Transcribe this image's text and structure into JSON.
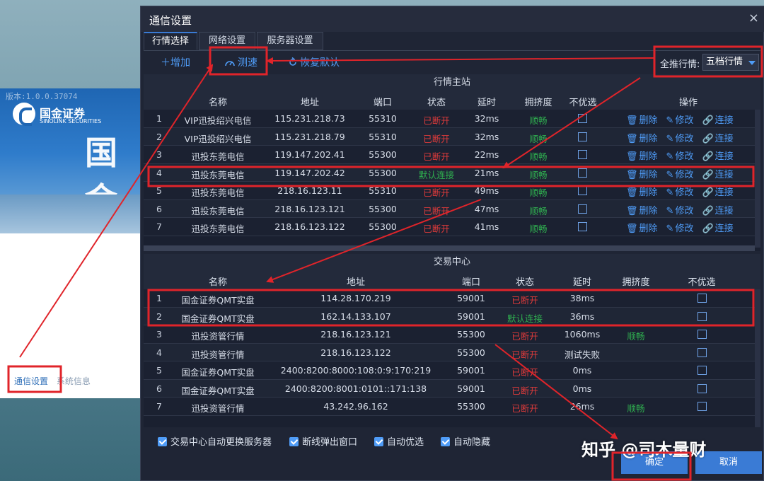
{
  "background_window": {
    "version": "版本:1.0.0.37074",
    "brand": "国金证券",
    "brand_en": "SINOLINK SECURITIES",
    "big_text": "国金",
    "links": [
      "通信设置",
      "系统信息"
    ]
  },
  "dialog": {
    "title": "通信设置",
    "close": "×",
    "tabs": [
      "行情选择",
      "网络设置",
      "服务器设置"
    ],
    "toolbar": {
      "add": "＋增加",
      "speed_test": "测速",
      "restore_default": "恢复默认",
      "push_label": "全推行情:",
      "push_value": "五档行情"
    },
    "market_panel": {
      "title": "行情主站",
      "headers": [
        "名称",
        "地址",
        "端口",
        "状态",
        "延时",
        "拥挤度",
        "不优选",
        "操作"
      ],
      "ops": [
        "删除",
        "修改",
        "连接"
      ],
      "rows": [
        {
          "no": "1",
          "name": "VIP迅投绍兴电信",
          "addr": "115.231.218.73",
          "port": "55310",
          "status": "已断开",
          "status_type": "red",
          "delay": "32ms",
          "crowd": "顺畅"
        },
        {
          "no": "2",
          "name": "VIP迅投绍兴电信",
          "addr": "115.231.218.79",
          "port": "55310",
          "status": "已断开",
          "status_type": "red",
          "delay": "32ms",
          "crowd": "顺畅"
        },
        {
          "no": "3",
          "name": "迅投东莞电信",
          "addr": "119.147.202.41",
          "port": "55300",
          "status": "已断开",
          "status_type": "red",
          "delay": "22ms",
          "crowd": "顺畅"
        },
        {
          "no": "4",
          "name": "迅投东莞电信",
          "addr": "119.147.202.42",
          "port": "55300",
          "status": "默认连接",
          "status_type": "green",
          "delay": "21ms",
          "crowd": "顺畅"
        },
        {
          "no": "5",
          "name": "迅投东莞电信",
          "addr": "218.16.123.11",
          "port": "55310",
          "status": "已断开",
          "status_type": "red",
          "delay": "49ms",
          "crowd": "顺畅"
        },
        {
          "no": "6",
          "name": "迅投东莞电信",
          "addr": "218.16.123.121",
          "port": "55300",
          "status": "已断开",
          "status_type": "red",
          "delay": "47ms",
          "crowd": "顺畅"
        },
        {
          "no": "7",
          "name": "迅投东莞电信",
          "addr": "218.16.123.122",
          "port": "55300",
          "status": "已断开",
          "status_type": "red",
          "delay": "41ms",
          "crowd": "顺畅"
        }
      ]
    },
    "trade_panel": {
      "title": "交易中心",
      "headers": [
        "名称",
        "地址",
        "端口",
        "状态",
        "延时",
        "拥挤度",
        "不优选"
      ],
      "rows": [
        {
          "no": "1",
          "name": "国金证券QMT实盘",
          "addr": "114.28.170.219",
          "port": "59001",
          "status": "已断开",
          "status_type": "red",
          "delay": "38ms",
          "crowd": ""
        },
        {
          "no": "2",
          "name": "国金证券QMT实盘",
          "addr": "162.14.133.107",
          "port": "59001",
          "status": "默认连接",
          "status_type": "green",
          "delay": "36ms",
          "crowd": ""
        },
        {
          "no": "3",
          "name": "迅投资管行情",
          "addr": "218.16.123.121",
          "port": "55300",
          "status": "已断开",
          "status_type": "red",
          "delay": "1060ms",
          "crowd": "顺畅"
        },
        {
          "no": "4",
          "name": "迅投资管行情",
          "addr": "218.16.123.122",
          "port": "55300",
          "status": "已断开",
          "status_type": "red",
          "delay": "测试失败",
          "crowd": ""
        },
        {
          "no": "5",
          "name": "国金证券QMT实盘",
          "addr": "2400:8200:8000:108:0:9:170:219",
          "port": "59001",
          "status": "已断开",
          "status_type": "red",
          "delay": "0ms",
          "crowd": ""
        },
        {
          "no": "6",
          "name": "国金证券QMT实盘",
          "addr": "2400:8200:8001:0101::171:138",
          "port": "59001",
          "status": "已断开",
          "status_type": "red",
          "delay": "0ms",
          "crowd": ""
        },
        {
          "no": "7",
          "name": "迅投资管行情",
          "addr": "43.242.96.162",
          "port": "55300",
          "status": "已断开",
          "status_type": "red",
          "delay": "26ms",
          "crowd": "顺畅"
        }
      ]
    },
    "options": [
      "交易中心自动更换服务器",
      "断线弹出窗口",
      "自动优选",
      "自动隐藏"
    ],
    "buttons": {
      "ok": "确定",
      "cancel": "取消"
    }
  },
  "watermark": "知乎 @司木量财",
  "colors": {
    "accent": "#4f9cf7",
    "red_status": "#e03b3b",
    "green_status": "#2fae4f",
    "annotation": "#e0242a"
  }
}
